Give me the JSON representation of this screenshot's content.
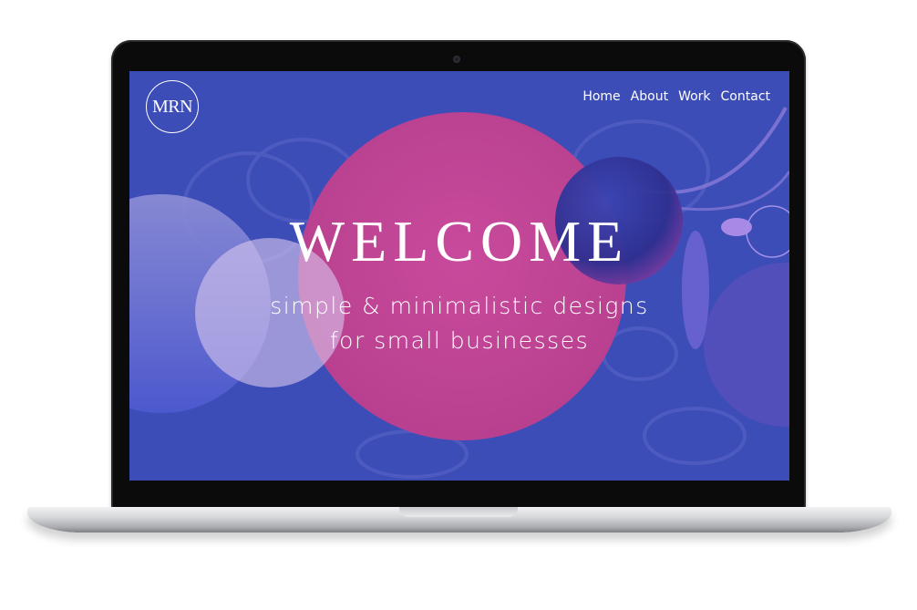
{
  "logo": {
    "text": "MRN"
  },
  "nav": {
    "items": [
      {
        "label": "Home"
      },
      {
        "label": "About"
      },
      {
        "label": "Work"
      },
      {
        "label": "Contact"
      }
    ]
  },
  "hero": {
    "title": "WELCOME",
    "subtitle_line1": "simple & minimalistic designs",
    "subtitle_line2": "for small businesses"
  },
  "colors": {
    "background": "#3d4db7",
    "pink_circle": "#c0449a",
    "text": "#ffffff"
  }
}
